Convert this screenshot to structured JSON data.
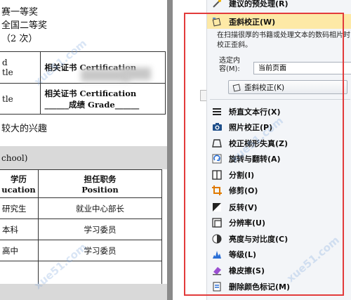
{
  "document": {
    "top_lines": [
      "赛一等奖",
      "全国二等奖",
      "（2 次）"
    ],
    "cert_table": [
      {
        "left_a": "d",
        "left_b": "tle",
        "cert_line1": "相关证书  Certification",
        "cert_line2": ""
      },
      {
        "left_a": "",
        "left_b": "tle",
        "cert_line1": "相关证书  Certification",
        "cert_line2": "______成绩 Grade______"
      }
    ],
    "interest_line": "较大的兴趣",
    "school_section": "chool)",
    "edu_table": {
      "header_left_1": "学历",
      "header_left_2": "ucation",
      "header_right_1": "担任职务",
      "header_right_2": "Position",
      "rows": [
        {
          "edu": "研究生",
          "position": "就业中心部长"
        },
        {
          "edu": "本科",
          "position": "学习委员"
        },
        {
          "edu": "高中",
          "position": "学习委员"
        }
      ]
    }
  },
  "panel": {
    "menu_top": {
      "label": "建议的预处理(R)"
    },
    "deskew_header": {
      "label": "歪斜校正(W)"
    },
    "deskew_description": "在扫描很厚的书籍或处理文本的数码相片时校正歪斜。",
    "scope_label_1": "选定内",
    "scope_label_2": "容(M):",
    "scope_value": "当前页面",
    "deskew_button": "歪斜校正(K)",
    "items": [
      {
        "label": "矫直文本行(X)"
      },
      {
        "label": "照片校正(P)"
      },
      {
        "label": "校正梯形失真(Z)"
      },
      {
        "label": "旋转与翻转(A)"
      },
      {
        "label": "分割(I)"
      },
      {
        "label": "修剪(O)"
      },
      {
        "label": "反转(V)"
      },
      {
        "label": "分辨率(U)"
      },
      {
        "label": "亮度与对比度(C)"
      },
      {
        "label": "等级(L)"
      },
      {
        "label": "橡皮擦(S)"
      },
      {
        "label": "删除颜色标记(M)"
      }
    ]
  },
  "highlight_color": "#e23b3b",
  "watermark": "xue51.com"
}
